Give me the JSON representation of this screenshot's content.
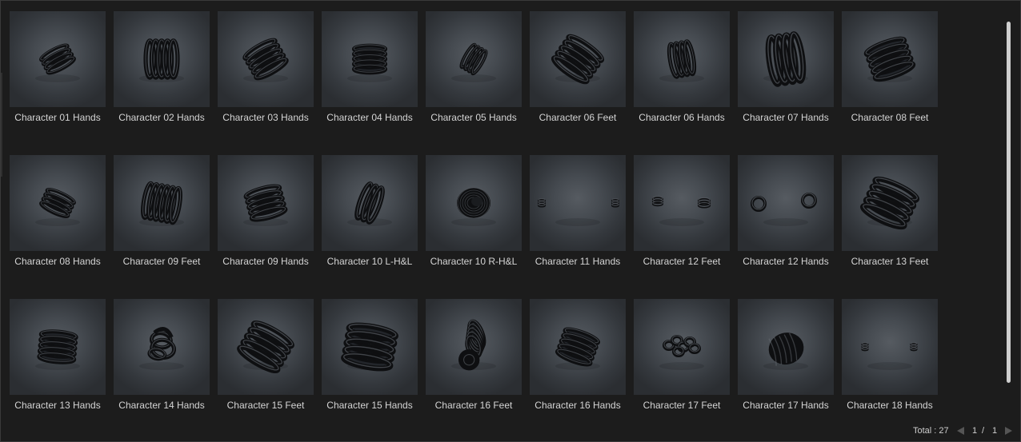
{
  "items": [
    {
      "label": "Character 01 Hands",
      "motif": "coil",
      "rot": -28,
      "sc": 0.85,
      "n": 4
    },
    {
      "label": "Character 02 Hands",
      "motif": "vcoil",
      "rot": 0,
      "sc": 1.05,
      "n": 5
    },
    {
      "label": "Character 03 Hands",
      "motif": "coil",
      "rot": -30,
      "sc": 1.0,
      "n": 5
    },
    {
      "label": "Character 04 Hands",
      "motif": "stack",
      "rot": 0,
      "sc": 0.9,
      "n": 5
    },
    {
      "label": "Character 05 Hands",
      "motif": "vcoil",
      "rot": 30,
      "sc": 0.75,
      "n": 4
    },
    {
      "label": "Character 06 Feet",
      "motif": "coil",
      "rot": 35,
      "sc": 1.15,
      "n": 5
    },
    {
      "label": "Character 06 Hands",
      "motif": "vcoil",
      "rot": -10,
      "sc": 0.95,
      "n": 4
    },
    {
      "label": "Character 07 Hands",
      "motif": "vcoil",
      "rot": -8,
      "sc": 1.35,
      "n": 4
    },
    {
      "label": "Character 08 Feet",
      "motif": "stack",
      "rot": -20,
      "sc": 1.15,
      "n": 5
    },
    {
      "label": "Character 08 Hands",
      "motif": "coil",
      "rot": 25,
      "sc": 0.85,
      "n": 4
    },
    {
      "label": "Character 09 Feet",
      "motif": "vcoil",
      "rot": 10,
      "sc": 1.0,
      "n": 6
    },
    {
      "label": "Character 09 Hands",
      "motif": "coil",
      "rot": -15,
      "sc": 1.0,
      "n": 5
    },
    {
      "label": "Character 10 L-H&L",
      "motif": "vcoil",
      "rot": 20,
      "sc": 1.05,
      "n": 3
    },
    {
      "label": "Character 10 R-H&L",
      "motif": "tire",
      "rot": 0,
      "sc": 1.0,
      "n": 0
    },
    {
      "label": "Character 11 Hands",
      "motif": "pair-small",
      "rot": 0,
      "sc": 1.0,
      "n": 0
    },
    {
      "label": "Character 12 Feet",
      "motif": "pair-coil",
      "rot": 0,
      "sc": 1.0,
      "n": 0
    },
    {
      "label": "Character 12 Hands",
      "motif": "pair-ring",
      "rot": 0,
      "sc": 1.0,
      "n": 0
    },
    {
      "label": "Character 13 Feet",
      "motif": "coil",
      "rot": 25,
      "sc": 1.3,
      "n": 5
    },
    {
      "label": "Character 13 Hands",
      "motif": "stack",
      "rot": 5,
      "sc": 1.0,
      "n": 5
    },
    {
      "label": "Character 14 Hands",
      "motif": "knot",
      "rot": 10,
      "sc": 1.0,
      "n": 0
    },
    {
      "label": "Character 15 Feet",
      "motif": "coil",
      "rot": 30,
      "sc": 1.25,
      "n": 5
    },
    {
      "label": "Character 15 Hands",
      "motif": "stack",
      "rot": 10,
      "sc": 1.35,
      "n": 5
    },
    {
      "label": "Character 16 Feet",
      "motif": "curl",
      "rot": -20,
      "sc": 1.1,
      "n": 0
    },
    {
      "label": "Character 16 Hands",
      "motif": "stack",
      "rot": 20,
      "sc": 1.0,
      "n": 5
    },
    {
      "label": "Character 17 Feet",
      "motif": "cluster",
      "rot": 0,
      "sc": 1.0,
      "n": 0
    },
    {
      "label": "Character 17 Hands",
      "motif": "bundle",
      "rot": -15,
      "sc": 1.1,
      "n": 0
    },
    {
      "label": "Character 18 Hands",
      "motif": "pair-tiny",
      "rot": 0,
      "sc": 1.0,
      "n": 0
    }
  ],
  "footer": {
    "total_text": "Total : 27",
    "page_current": "1",
    "page_separator": "/",
    "page_total": "1"
  }
}
